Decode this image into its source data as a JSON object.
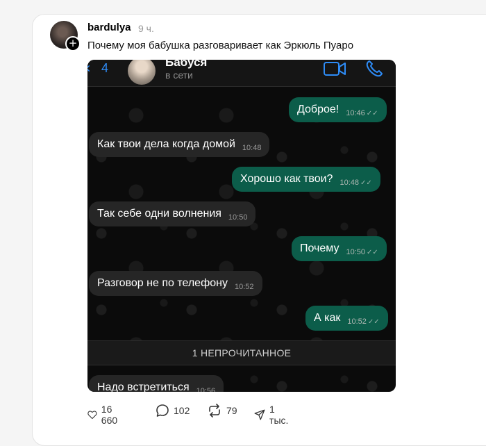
{
  "post": {
    "username": "bardulya",
    "time": "9 ч.",
    "text": "Почему моя бабушка разговаривает как Эркюль Пуаро"
  },
  "chat": {
    "header": {
      "back_count": "4",
      "contact_name": "Бабуся",
      "status": "в сети"
    },
    "messages": [
      {
        "dir": "out",
        "text": "Доброе!",
        "time": "10:46"
      },
      {
        "dir": "in",
        "text": "Как твои дела когда домой",
        "time": "10:48"
      },
      {
        "dir": "out",
        "text": "Хорошо как твои?",
        "time": "10:48"
      },
      {
        "dir": "in",
        "text": "Так себе одни волнения",
        "time": "10:50"
      },
      {
        "dir": "out",
        "text": "Почему",
        "time": "10:50"
      },
      {
        "dir": "in",
        "text": "Разговор не по телефону",
        "time": "10:52"
      },
      {
        "dir": "out",
        "text": "А как",
        "time": "10:52"
      },
      {
        "dir": "in",
        "text": "Надо встретиться",
        "time": "10:56"
      }
    ],
    "unread_label": "1 НЕПРОЧИТАННОЕ"
  },
  "actions": {
    "likes": "16 660",
    "comments": "102",
    "reposts": "79",
    "shares": "1 тыс."
  },
  "colors": {
    "outgoing_bubble": "#0c5d4a",
    "incoming_bubble": "#262626",
    "accent_blue": "#2e8cf7"
  }
}
